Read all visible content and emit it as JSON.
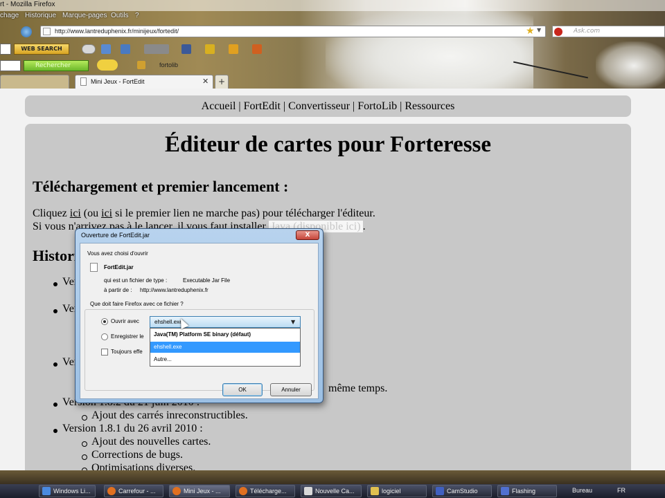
{
  "window": {
    "title": "rt - Mozilla Firefox"
  },
  "menubar": {
    "items": [
      "chage",
      "Historique",
      "Marque-pages",
      "Outils",
      "?"
    ]
  },
  "navbar": {
    "url": "http://www.lantreduphenix.fr/minijeux/fortedit/",
    "search_placeholder": "Ask.com"
  },
  "toolbar1": {
    "web_search_label": "WEB SEARCH"
  },
  "toolbar2": {
    "search_button": "Rechercher",
    "fortolib_label": "fortolib"
  },
  "tabs": {
    "active_title": "Mini Jeux - FortEdit",
    "new_tab": "+"
  },
  "page": {
    "nav": {
      "links": [
        "Accueil",
        "FortEdit",
        "Convertisseur",
        "FortoLib",
        "Ressources"
      ],
      "separator": "|"
    },
    "title": "Éditeur de cartes pour Forteresse",
    "download_heading": "Téléchargement et premier lancement :",
    "line1_a": "Cliquez ",
    "line1_link1": "ici",
    "line1_b": " (ou ",
    "line1_link2": "ici",
    "line1_c": " si le premier lien ne marche pas) pour télécharger l'éditeur.",
    "line2_a": "Si vous n'arrivez pas à le lancer, il vous faut installer ",
    "line2_hl": "Java (disponible ici)",
    "line2_c": ".",
    "history_heading": "Historique :",
    "versions": [
      {
        "label": "Version 1.0.4"
      },
      {
        "label": "Version 1.0.3"
      },
      {
        "label": "Version 1.0.3"
      }
    ],
    "same_time_text": "même temps.",
    "v182_label": "Version 1.8.2 du 21 juin 2010 :",
    "v182_items": [
      "Ajout des carrés inreconstructibles."
    ],
    "v181_label": "Version 1.8.1 du 26 avril 2010 :",
    "v181_items": [
      "Ajout des nouvelles cartes.",
      "Corrections de bugs.",
      "Optimisations diverses."
    ]
  },
  "dialog": {
    "title": "Ouverture de FortEdit.jar",
    "close": "X",
    "chosen_text": "Vous avez choisi d'ouvrir",
    "filename": "FortEdit.jar",
    "type_label": "qui est un fichier de type :",
    "type_value": "Executable Jar File",
    "from_label": "à partir de :",
    "from_value": "http://www.lantreduphenix.fr",
    "question": "Que doit faire Firefox avec ce fichier ?",
    "open_with_label": "Ouvrir avec",
    "selected_app": "ehshell.exe",
    "save_label": "Enregistrer le",
    "always_label": "Toujours effe",
    "options": [
      "Java(TM) Platform SE binary (défaut)",
      "ehshell.exe",
      "Autre..."
    ],
    "ok": "OK",
    "cancel": "Annuler"
  },
  "taskbar": {
    "buttons": [
      "Windows Li...",
      "Carrefour - ...",
      "Mini Jeux - ...",
      "Télécharge...",
      "Nouvelle Ca...",
      "logiciel",
      "CamStudio",
      "Flashing"
    ],
    "bureau": "Bureau",
    "lang": "FR"
  }
}
